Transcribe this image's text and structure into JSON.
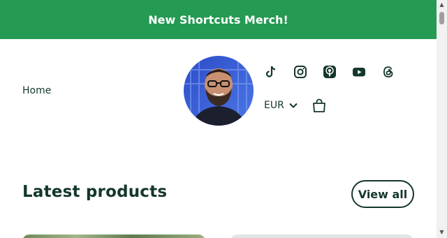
{
  "announcement": {
    "text": "New Shortcuts Merch!"
  },
  "nav": {
    "home_label": "Home"
  },
  "header": {
    "social_icons": [
      "tiktok-icon",
      "instagram-icon",
      "podcasts-icon",
      "youtube-icon",
      "threads-icon"
    ],
    "currency": {
      "selected": "EUR"
    },
    "cart_icon": "shopping-bag-icon"
  },
  "products": {
    "title": "Latest products",
    "view_all_label": "View all"
  },
  "colors": {
    "announcement_bg": "#249a52",
    "text_dark": "#14372c",
    "background": "#ffffff"
  }
}
